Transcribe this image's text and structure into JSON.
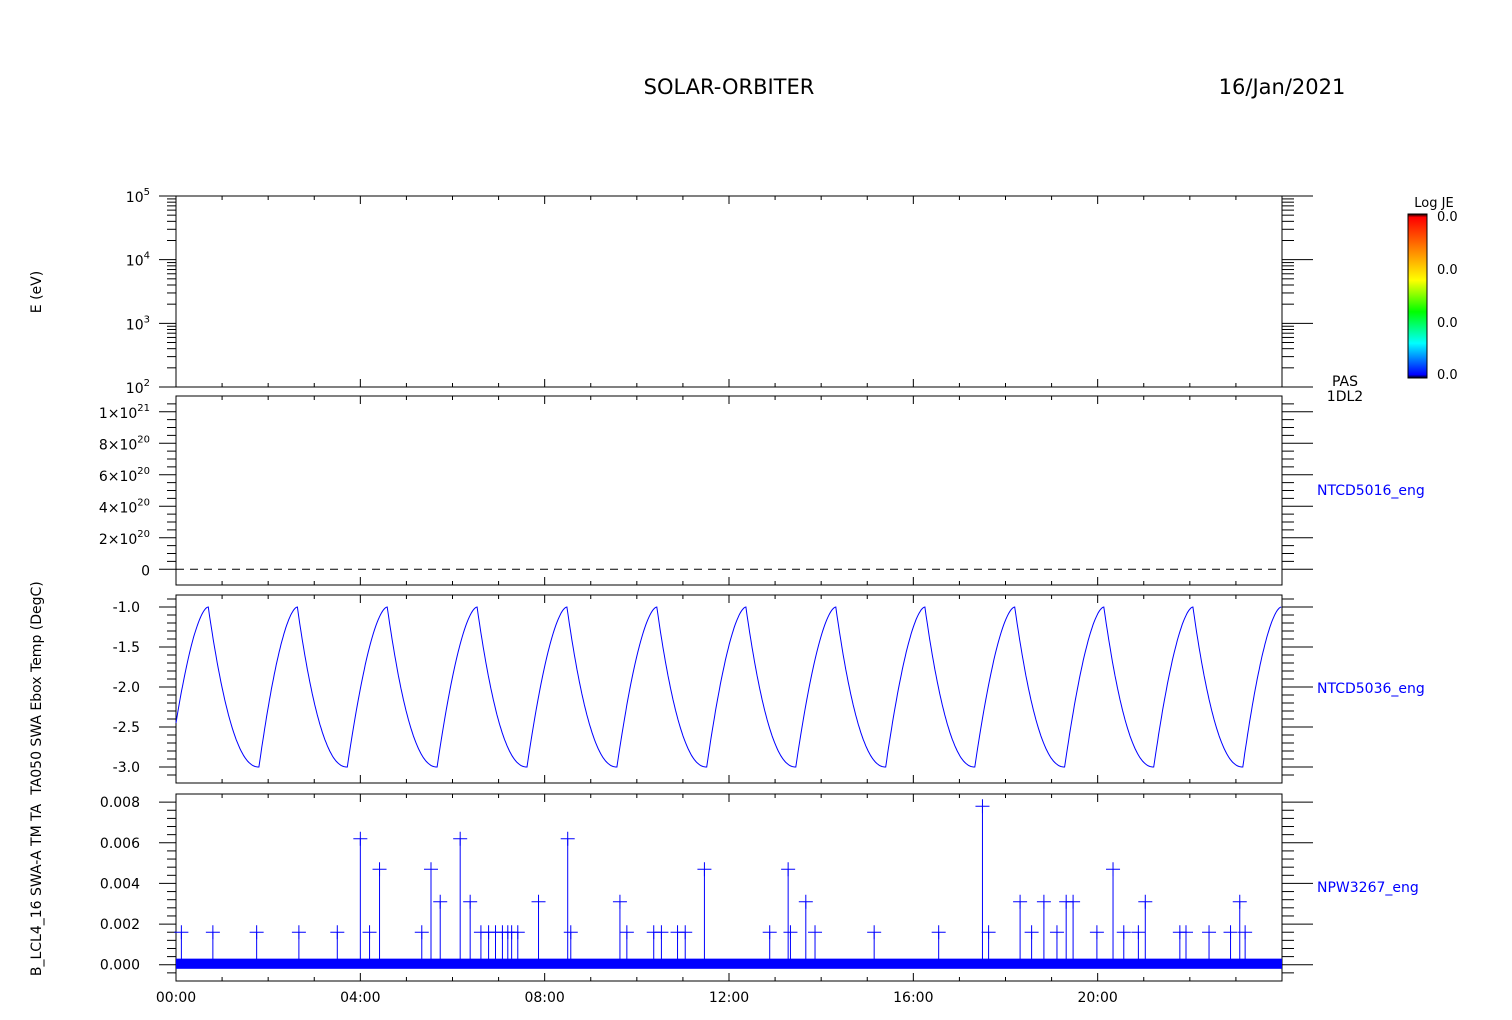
{
  "header": {
    "mission": "SOLAR-ORBITER",
    "date": "16/Jan/2021"
  },
  "colorbar": {
    "title": "Log JE",
    "tick_labels": [
      "0.0",
      "0.0",
      "0.0",
      "0.0"
    ],
    "colors": [
      "#000000",
      "#0000ff",
      "#00ffff",
      "#00ff00",
      "#ffff00",
      "#ff8000",
      "#ff0000",
      "#000000"
    ]
  },
  "line_color": "#0000ff",
  "chart_data": [
    {
      "type": "heatmap",
      "ylabel": "E (eV)",
      "yscale": "log",
      "ylim": [
        100,
        100000
      ],
      "ytick_labels": [
        {
          "base": "10",
          "exp": "5"
        },
        {
          "base": "10",
          "exp": "4"
        },
        {
          "base": "10",
          "exp": "3"
        },
        {
          "base": "10",
          "exp": "2"
        }
      ],
      "right_label_lines": [
        "PAS",
        "1DL2"
      ],
      "values": []
    },
    {
      "type": "line",
      "ylabel": "",
      "ylim": [
        -1e+20,
        1.1e+21
      ],
      "ytick_labels": [
        {
          "base": "1×10",
          "exp": "21"
        },
        {
          "base": "8×10",
          "exp": "20"
        },
        {
          "base": "6×10",
          "exp": "20"
        },
        {
          "base": "4×10",
          "exp": "20"
        },
        {
          "base": "2×10",
          "exp": "20"
        },
        {
          "base": "0",
          "exp": ""
        }
      ],
      "series_label": "NTCD5016_eng",
      "series": [
        {
          "name": "NTCD5016_eng",
          "x": [
            "00:00",
            "23:59"
          ],
          "y": [
            0,
            0
          ],
          "style": "dashed"
        }
      ]
    },
    {
      "type": "line",
      "ylabel": "TA050 SWA Ebox Temp (DegC)",
      "ylim": [
        -3.2,
        -0.85
      ],
      "yticks": [
        -1.0,
        -1.5,
        -2.0,
        -2.5,
        -3.0
      ],
      "ytick_labels": [
        "-1.0",
        "-1.5",
        "-2.0",
        "-2.5",
        "-3.0"
      ],
      "series_label": "NTCD5036_eng",
      "series": [
        {
          "name": "NTCD5036_eng",
          "x": [
            "00:00",
            "00:42",
            "01:48",
            "02:38",
            "03:43",
            "04:35",
            "05:40",
            "06:32",
            "07:37",
            "08:29",
            "09:34",
            "10:26",
            "11:31",
            "12:22",
            "13:27",
            "14:19",
            "15:24",
            "16:15",
            "17:20",
            "18:12",
            "19:17",
            "20:08",
            "21:13",
            "22:04",
            "23:09",
            "23:59"
          ],
          "y": [
            -2.45,
            -1.0,
            -3.0,
            -1.0,
            -3.0,
            -1.0,
            -3.0,
            -1.0,
            -3.0,
            -1.0,
            -3.0,
            -1.0,
            -3.0,
            -1.0,
            -3.0,
            -1.0,
            -3.0,
            -1.0,
            -3.0,
            -1.0,
            -3.0,
            -1.0,
            -3.0,
            -1.0,
            -3.0,
            -1.0
          ]
        }
      ]
    },
    {
      "type": "scatter",
      "ylabel": "B_LCL4_16 SWA-A TM TA",
      "ylim": [
        -0.0008,
        0.0084
      ],
      "yticks": [
        0.008,
        0.006,
        0.004,
        0.002,
        0.0
      ],
      "ytick_labels": [
        "0.008",
        "0.006",
        "0.004",
        "0.002",
        "0.000"
      ],
      "series_label": "NPW3267_eng",
      "baseline_band": [
        -0.0002,
        0.0003
      ],
      "series": [
        {
          "name": "NPW3267_eng",
          "x": [
            "00:07",
            "00:48",
            "01:45",
            "02:40",
            "03:30",
            "04:00",
            "04:12",
            "04:25",
            "05:20",
            "05:32",
            "05:44",
            "06:10",
            "06:23",
            "06:37",
            "06:47",
            "06:56",
            "07:05",
            "07:12",
            "07:17",
            "07:25",
            "07:52",
            "08:30",
            "08:34",
            "09:38",
            "09:47",
            "10:22",
            "10:32",
            "10:53",
            "11:03",
            "11:28",
            "12:53",
            "13:17",
            "13:20",
            "13:40",
            "13:52",
            "15:09",
            "16:33",
            "17:30",
            "17:38",
            "18:19",
            "18:34",
            "18:50",
            "19:07",
            "19:19",
            "19:28",
            "19:59",
            "20:20",
            "20:34",
            "20:53",
            "21:02",
            "21:47",
            "21:55",
            "22:25",
            "22:53",
            "23:05",
            "23:12"
          ],
          "y": [
            0.0016,
            0.0016,
            0.0016,
            0.0016,
            0.0016,
            0.0062,
            0.0016,
            0.0047,
            0.0016,
            0.0047,
            0.0031,
            0.0062,
            0.0031,
            0.0016,
            0.0016,
            0.0016,
            0.0016,
            0.0016,
            0.0016,
            0.0016,
            0.0031,
            0.0062,
            0.0016,
            0.0031,
            0.0016,
            0.0016,
            0.0016,
            0.0016,
            0.0016,
            0.0047,
            0.0016,
            0.0047,
            0.0016,
            0.0031,
            0.0016,
            0.0016,
            0.0016,
            0.0078,
            0.0016,
            0.0031,
            0.0016,
            0.0031,
            0.0016,
            0.0031,
            0.0031,
            0.0016,
            0.0047,
            0.0016,
            0.0016,
            0.0031,
            0.0016,
            0.0016,
            0.0016,
            0.0016,
            0.0031,
            0.0016
          ]
        }
      ]
    }
  ],
  "x_axis": {
    "tick_labels": [
      "00:00",
      "04:00",
      "08:00",
      "12:00",
      "16:00",
      "20:00"
    ]
  }
}
